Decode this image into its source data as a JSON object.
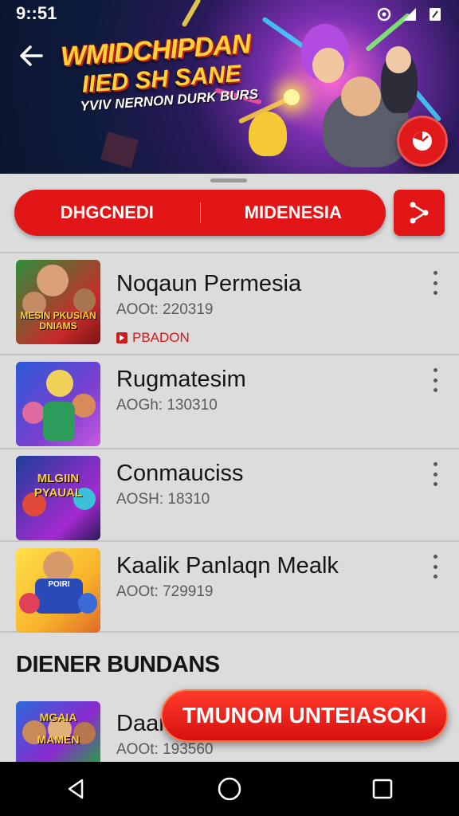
{
  "status_bar": {
    "time": "9::51",
    "icons": [
      "sync-icon",
      "signal-icon",
      "battery-icon"
    ]
  },
  "banner": {
    "title_line1": "WMIDCHIPDAN",
    "title_line2": "IIED SH SANE",
    "title_line3": "YVIV NERNON DURK BURS",
    "back_icon": "arrow-left-icon",
    "fab_icon": "pie-chart-icon"
  },
  "tabs": [
    {
      "label": "DHGCNEDI"
    },
    {
      "label": "MIDENESIA"
    }
  ],
  "share_icon": "share-icon",
  "items": [
    {
      "title": "Noqaun Permesia",
      "sub": "AOOt: 220319",
      "badge": "PBADON",
      "thumb_text": "MESIN PKUSIAN DNIAMS"
    },
    {
      "title": "Rugmatesim",
      "sub": "AOGh: 130310"
    },
    {
      "title": "Conmauciss",
      "sub": "AOSH: 18310",
      "thumb_text": "MLGIIN PYAUAL"
    },
    {
      "title": "Kaalik Panlaqn Mealk",
      "sub": "AOOt: 729919",
      "thumb_text": "POIRI"
    }
  ],
  "section_title": "DIENER BUNDANS",
  "last_item": {
    "title": "Daar",
    "sub": "AOOt: 193560",
    "thumb_text": "MGAIA MAMEN"
  },
  "cta_label": "TMUNOM UNTEIASOKI",
  "colors": {
    "accent": "#e21616",
    "background": "#dcdcdc",
    "nav": "#000000"
  },
  "nav_icons": [
    "back-triangle-icon",
    "home-circle-icon",
    "recents-square-icon"
  ]
}
